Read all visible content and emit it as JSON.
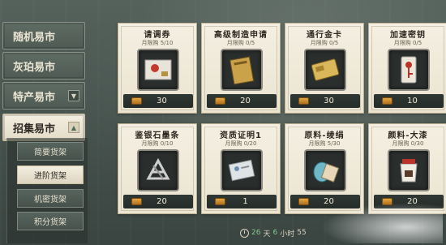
{
  "sidebar": {
    "tabs": [
      {
        "label": "随机易市"
      },
      {
        "label": "灰珀易市"
      },
      {
        "label": "特产易市"
      },
      {
        "label": "招集易市"
      }
    ],
    "sub_tabs": [
      {
        "label": "简要货架"
      },
      {
        "label": "进阶货架"
      },
      {
        "label": "机密货架"
      },
      {
        "label": "积分货架"
      }
    ]
  },
  "cards": [
    {
      "title": "请调券",
      "limit": "月限购 5/10",
      "price": "30"
    },
    {
      "title": "高级制造申请",
      "limit": "月限购 0/5",
      "price": "20"
    },
    {
      "title": "通行金卡",
      "limit": "月限购 0/5",
      "price": "30"
    },
    {
      "title": "加速密钥",
      "limit": "月限购 0/5",
      "price": "10"
    },
    {
      "title": "鉴银石墨条",
      "limit": "月限购 0/10",
      "price": "20"
    },
    {
      "title": "资质证明1",
      "limit": "月限购 0/20",
      "price": "1"
    },
    {
      "title": "原料-绫绢",
      "limit": "月限购 5/30",
      "price": "20"
    },
    {
      "title": "颜料-大漆",
      "limit": "月限购 0/30",
      "price": "20"
    }
  ],
  "timer": {
    "days": "26",
    "day_unit": "天",
    "hours": "6",
    "hour_unit": "小时",
    "minutes": "55"
  },
  "colors": {
    "accent_green": "#7ec98a",
    "card_bg": "#f4efe2",
    "sidebar_bg": "#4e5a53"
  },
  "icons": [
    "chevron-down-icon",
    "chevron-up-icon",
    "coin-icon",
    "clock-icon"
  ]
}
